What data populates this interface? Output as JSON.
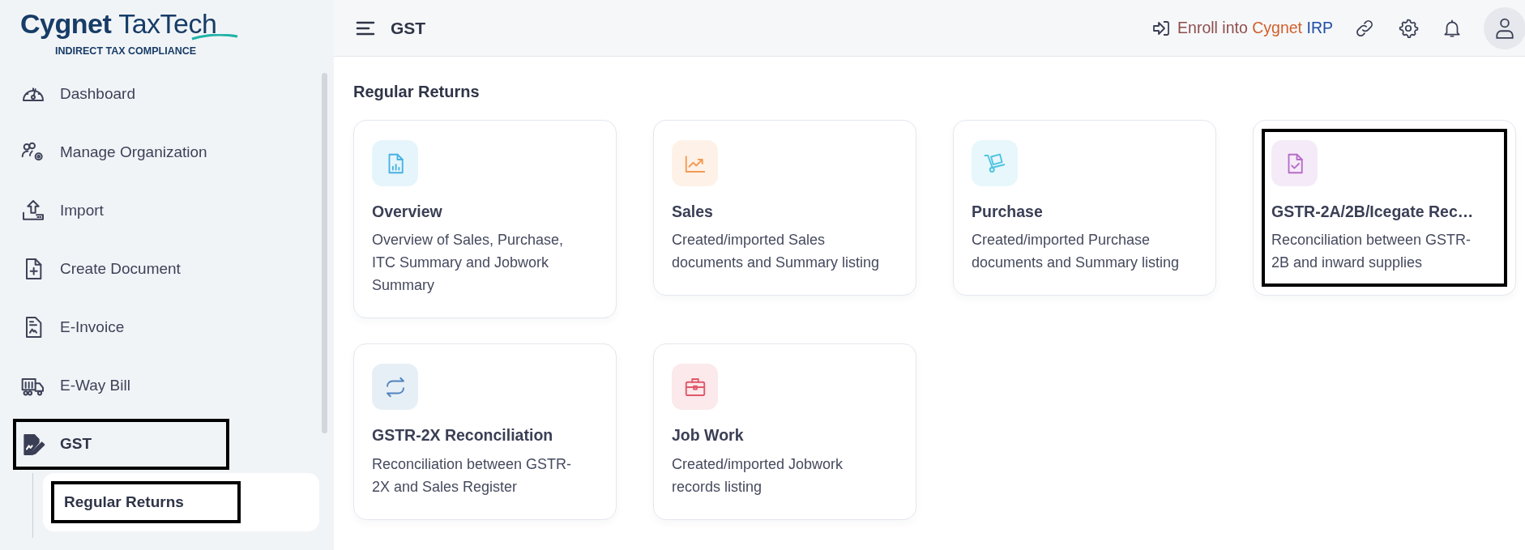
{
  "logo": {
    "name_bold": "Cygnet",
    "name_light": "TaxTech",
    "tagline": "INDIRECT TAX COMPLIANCE"
  },
  "sidebar": {
    "items": [
      {
        "label": "Dashboard",
        "selected": false,
        "highlighted": false
      },
      {
        "label": "Manage Organization",
        "selected": false,
        "highlighted": false
      },
      {
        "label": "Import",
        "selected": false,
        "highlighted": false
      },
      {
        "label": "Create Document",
        "selected": false,
        "highlighted": false
      },
      {
        "label": "E-Invoice",
        "selected": false,
        "highlighted": false
      },
      {
        "label": "E-Way Bill",
        "selected": false,
        "highlighted": false
      },
      {
        "label": "GST",
        "selected": true,
        "highlighted": true,
        "children": [
          {
            "label": "Regular Returns",
            "selected": true,
            "highlighted": true
          }
        ]
      }
    ]
  },
  "topbar": {
    "title": "GST",
    "enroll_link": [
      {
        "text": "Enroll into",
        "color": "#8e4c4c"
      },
      {
        "text": "Cygnet",
        "color": "#d25f2b"
      },
      {
        "text": "IRP",
        "color": "#1f4ea6"
      }
    ]
  },
  "section": {
    "heading": "Regular Returns",
    "cards": [
      {
        "title": "Overview",
        "description": "Overview of Sales, Purchase, ITC Summary and Jobwork Summary",
        "color": "#47b3e3",
        "highlighted": false
      },
      {
        "title": "Sales",
        "description": "Created/imported Sales documents and Summary listing",
        "color": "#f59a55",
        "highlighted": false
      },
      {
        "title": "Purchase",
        "description": "Created/imported Purchase documents and Summary listing",
        "color": "#4dc3e2",
        "highlighted": false
      },
      {
        "title": "GSTR-2A/2B/Icegate Rec…",
        "description": "Reconciliation between GSTR-2B and inward supplies",
        "color": "#b66cc8",
        "highlighted": true
      },
      {
        "title": "GSTR-2X Reconciliation",
        "description": "Reconciliation between GSTR-2X and Sales Register",
        "color": "#4d84be",
        "highlighted": false
      },
      {
        "title": "Job Work",
        "description": "Created/imported Jobwork records listing",
        "color": "#e0576a",
        "highlighted": false
      }
    ]
  }
}
